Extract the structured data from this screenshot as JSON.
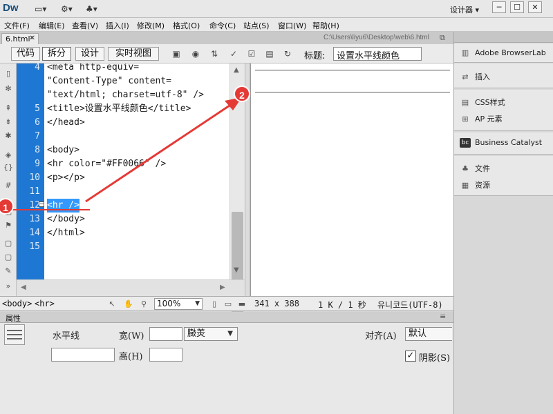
{
  "app": {
    "logo": "Dw",
    "workspace": "设计器",
    "window_buttons": [
      "─",
      "☐",
      "✕"
    ]
  },
  "menu": [
    "文件(F)",
    "编辑(E)",
    "查看(V)",
    "插入(I)",
    "修改(M)",
    "格式(O)",
    "命令(C)",
    "站点(S)",
    "窗口(W)",
    "帮助(H)"
  ],
  "document": {
    "tab_label": "6.html*",
    "path": "C:\\Users\\liyu6\\Desktop\\web\\6.html"
  },
  "toolbar": {
    "views": [
      "代码",
      "拆分",
      "设计",
      "实时视图"
    ],
    "active_view": "拆分",
    "title_label": "标题:",
    "title_value": "设置水平线颜色"
  },
  "code": {
    "lines": [
      {
        "num": "4",
        "text": "<meta http-equiv="
      },
      {
        "num": "",
        "text": "\"Content-Type\" content="
      },
      {
        "num": "",
        "text": "\"text/html; charset=utf-8\" />"
      },
      {
        "num": "5",
        "text": "<title>设置水平线颜色</title>"
      },
      {
        "num": "6",
        "text": "</head>"
      },
      {
        "num": "7",
        "text": ""
      },
      {
        "num": "8",
        "text": "<body>"
      },
      {
        "num": "9",
        "text": "<hr color=\"#FF0066\" />"
      },
      {
        "num": "10",
        "text": "<p></p>"
      },
      {
        "num": "11",
        "text": ""
      },
      {
        "num": "12",
        "text": "<hr />"
      },
      {
        "num": "13",
        "text": "</body>"
      },
      {
        "num": "14",
        "text": "</html>"
      },
      {
        "num": "15",
        "text": ""
      }
    ],
    "selected_line": "12"
  },
  "statusbar": {
    "tags": [
      "<body>",
      "<hr>"
    ],
    "zoom": "100%",
    "dimensions": "341 x 388",
    "size_time": "1 K / 1 秒",
    "encoding": "유니코드(UTF-8)"
  },
  "properties": {
    "header": "属性",
    "element_name": "水平线",
    "width_label": "宽(W)",
    "unit_value": "臌羙",
    "height_label": "高(H)",
    "align_label": "对齐(A)",
    "align_value": "默认",
    "shade_label": "阴影(S)",
    "shade_checked": true
  },
  "right_panel": {
    "groups": [
      [
        "Adobe BrowserLab"
      ],
      [
        "插入"
      ],
      [
        "CSS样式",
        "AP 元素"
      ],
      [
        "Business Catalyst"
      ],
      [
        "文件",
        "资源"
      ]
    ]
  },
  "annotations": {
    "badge_1": "1",
    "badge_2": "2"
  },
  "colors": {
    "gutter": "#1e78d3",
    "selection": "#3399ff",
    "annotation": "#e53935"
  }
}
